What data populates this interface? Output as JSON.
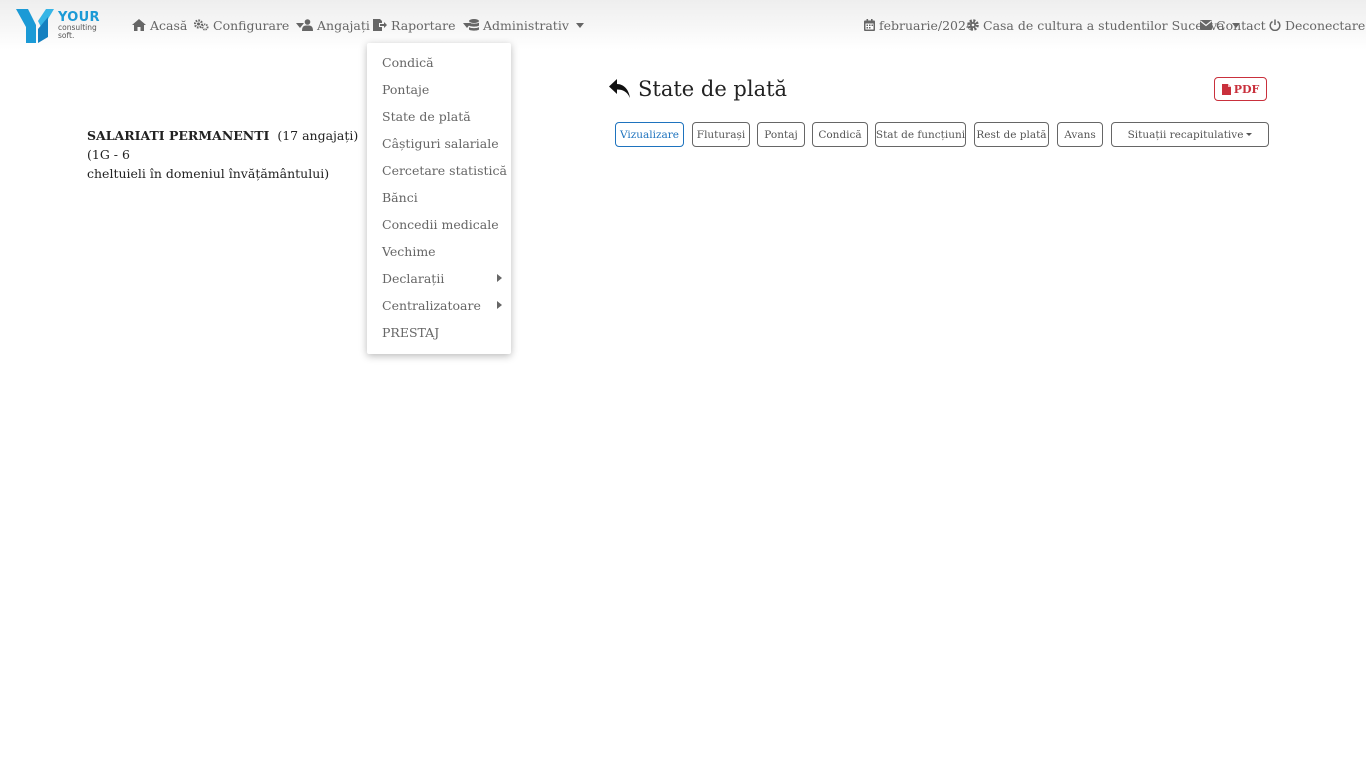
{
  "brand": {
    "name": "YOUR",
    "tagline": "consulting soft."
  },
  "nav": {
    "home": "Acasă",
    "config": "Configurare",
    "employees": "Angajați",
    "reports": "Raportare",
    "admin": "Administrativ",
    "period": "februarie/2024",
    "organization": "Casa de cultura a studentilor Suceava",
    "contact": "Contact",
    "logout": "Deconectare"
  },
  "reports_menu": {
    "items": [
      {
        "label": "Condică"
      },
      {
        "label": "Pontaje"
      },
      {
        "label": "State de plată"
      },
      {
        "label": "Câștiguri salariale"
      },
      {
        "label": "Cercetare statistică"
      },
      {
        "label": "Bănci"
      },
      {
        "label": "Concedii medicale"
      },
      {
        "label": "Vechime"
      },
      {
        "label": "Declarații",
        "submenu": true
      },
      {
        "label": "Centralizatoare",
        "submenu": true
      },
      {
        "label": "PRESTAJ"
      }
    ]
  },
  "page": {
    "title": "State de plată",
    "pdf_label": "PDF",
    "group_name": "SALARIATI PERMANENTI",
    "group_count": "(17 angajați)",
    "group_detail": "(1G - 6",
    "group_detail_line2": "cheltuieli în domeniul învățământului)"
  },
  "tabs": {
    "items": [
      {
        "label": "Vizualizare",
        "active": true
      },
      {
        "label": "Fluturași"
      },
      {
        "label": "Pontaj"
      },
      {
        "label": "Condică"
      },
      {
        "label": "Stat de funcțiuni"
      },
      {
        "label": "Rest de plată"
      },
      {
        "label": "Avans"
      },
      {
        "label": "Situații recapitulative",
        "dropdown": true
      }
    ]
  },
  "colors": {
    "accent": "#1e73be",
    "danger": "#c9303c",
    "brand": "#1b9ad6"
  }
}
